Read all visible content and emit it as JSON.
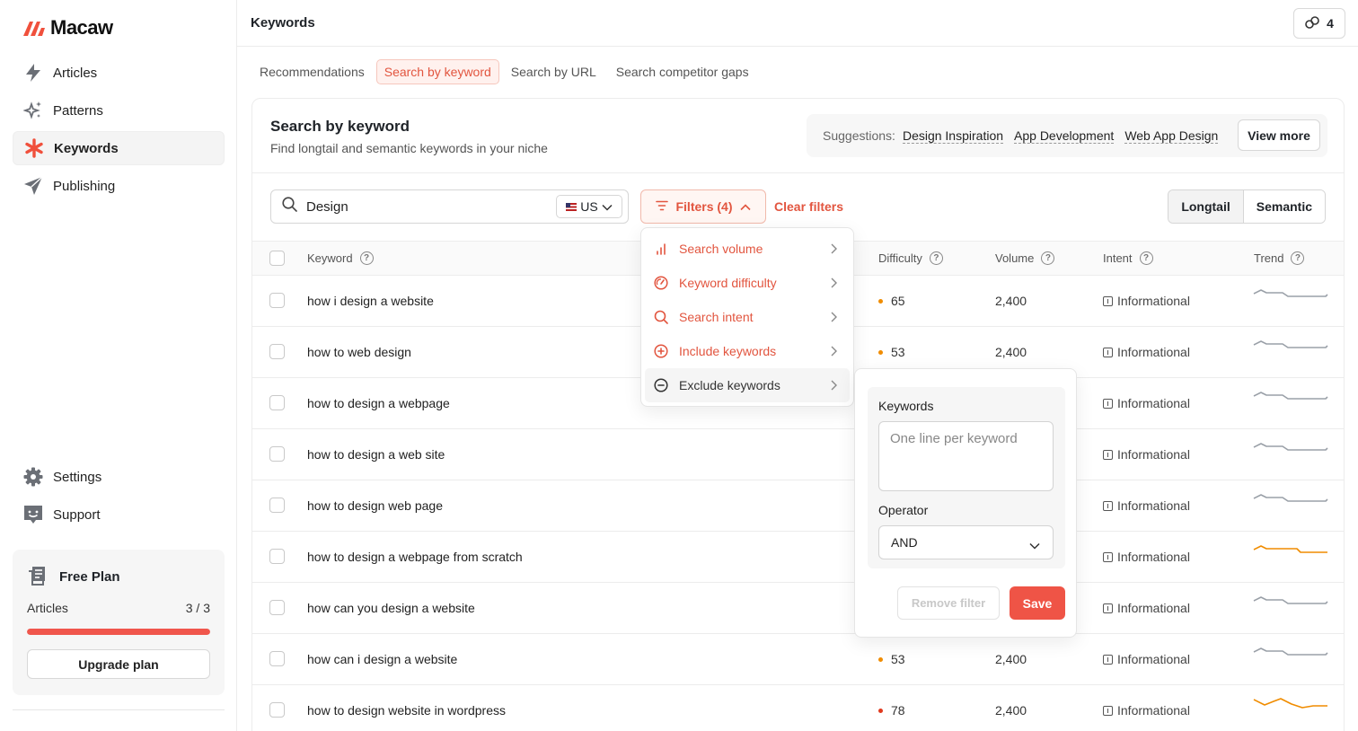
{
  "app": {
    "name": "Macaw"
  },
  "sidebar": {
    "items": [
      {
        "label": "Articles",
        "icon": "bolt-icon"
      },
      {
        "label": "Patterns",
        "icon": "sparkles-icon"
      },
      {
        "label": "Keywords",
        "icon": "asterisk-icon",
        "active": true
      },
      {
        "label": "Publishing",
        "icon": "send-icon"
      }
    ],
    "bottom_items": [
      {
        "label": "Settings",
        "icon": "gear-icon"
      },
      {
        "label": "Support",
        "icon": "support-icon"
      }
    ],
    "plan": {
      "title": "Free Plan",
      "usage_label": "Articles",
      "usage_value": "3 / 3",
      "progress": 1.0,
      "upgrade_label": "Upgrade plan"
    }
  },
  "header": {
    "title": "Keywords",
    "credits": "4"
  },
  "tabs": [
    {
      "label": "Recommendations"
    },
    {
      "label": "Search by keyword",
      "active": true
    },
    {
      "label": "Search by URL"
    },
    {
      "label": "Search competitor gaps"
    }
  ],
  "card": {
    "title": "Search by keyword",
    "subtitle": "Find longtail and semantic keywords in your niche",
    "suggestions_label": "Suggestions:",
    "suggestions": [
      "Design Inspiration",
      "App Development",
      "Web App Design"
    ],
    "view_more": "View more"
  },
  "search": {
    "value": "Design",
    "country": "US"
  },
  "filters": {
    "label": "Filters (4)",
    "clear_label": "Clear filters"
  },
  "mode": {
    "options": [
      "Longtail",
      "Semantic"
    ],
    "selected": "Longtail"
  },
  "table": {
    "headers": {
      "keyword": "Keyword",
      "difficulty": "Difficulty",
      "volume": "Volume",
      "intent": "Intent",
      "trend": "Trend"
    },
    "rows": [
      {
        "keyword": "how i design a website",
        "difficulty": "65",
        "volume": "2,400",
        "intent": "Informational",
        "trend": "flat"
      },
      {
        "keyword": "how to web design",
        "difficulty": "53",
        "volume": "2,400",
        "intent": "Informational",
        "trend": "flat"
      },
      {
        "keyword": "how to design a webpage",
        "difficulty": "",
        "volume": "",
        "intent": "Informational",
        "trend": "flat"
      },
      {
        "keyword": "how to design a web site",
        "difficulty": "",
        "volume": "",
        "intent": "Informational",
        "trend": "flat"
      },
      {
        "keyword": "how to design web page",
        "difficulty": "",
        "volume": "",
        "intent": "Informational",
        "trend": "flat"
      },
      {
        "keyword": "how to design a webpage from scratch",
        "difficulty": "",
        "volume": "",
        "intent": "Informational",
        "trend": "orange-flat"
      },
      {
        "keyword": "how can you design a website",
        "difficulty": "",
        "volume": "",
        "intent": "Informational",
        "trend": "flat"
      },
      {
        "keyword": "how can i design a website",
        "difficulty": "53",
        "volume": "2,400",
        "intent": "Informational",
        "trend": "flat"
      },
      {
        "keyword": "how to design website in wordpress",
        "difficulty": "78",
        "volume": "2,400",
        "intent": "Informational",
        "trend": "orange-wave"
      }
    ]
  },
  "filter_menu": {
    "items": [
      {
        "label": "Search volume",
        "icon": "bar-chart-icon"
      },
      {
        "label": "Keyword difficulty",
        "icon": "gauge-icon"
      },
      {
        "label": "Search intent",
        "icon": "search-icon"
      },
      {
        "label": "Include keywords",
        "icon": "plus-circle-icon"
      },
      {
        "label": "Exclude keywords",
        "icon": "minus-circle-icon",
        "hover": true
      }
    ]
  },
  "exclude_panel": {
    "keywords_label": "Keywords",
    "keywords_placeholder": "One line per keyword",
    "operator_label": "Operator",
    "operator_value": "AND",
    "remove_label": "Remove filter",
    "save_label": "Save"
  },
  "colors": {
    "accent": "#e2553f",
    "save": "#ef5446",
    "orange_dot": "#f08c00",
    "red_dot": "#e03a1e"
  }
}
